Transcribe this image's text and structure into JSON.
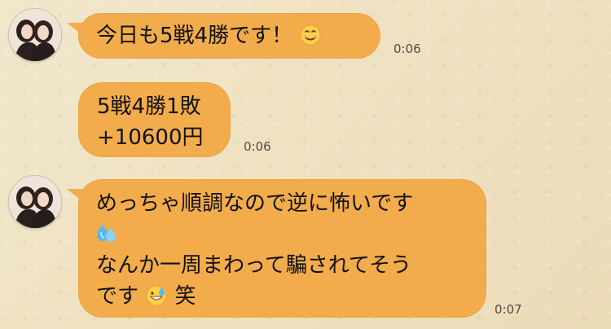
{
  "messages": [
    {
      "line1": "今日も5戦4勝です！",
      "emoji": "smiling-face-icon",
      "time": "0:06"
    },
    {
      "line1": "5戦4勝1敗",
      "line2": "+10600円",
      "time": "0:06"
    },
    {
      "line1": "めっちゃ順調なので逆に怖いです",
      "emoji_line2": "sweat-droplets-icon",
      "line3": "なんか一周まわって騙されてそう",
      "line4_text": "です",
      "emoji_line4": "grinning-sweat-icon",
      "line4_suffix": "笑",
      "time": "0:07"
    }
  ]
}
